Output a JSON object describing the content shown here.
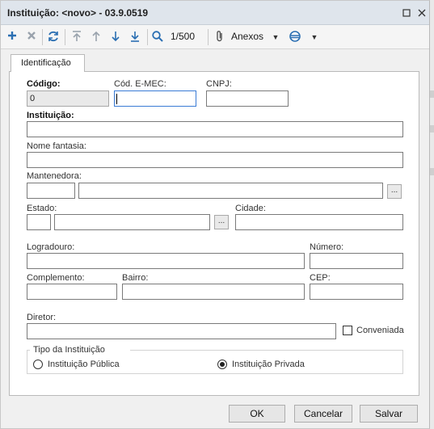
{
  "window": {
    "title": "Instituição: <novo> - 03.9.0519",
    "controls": {
      "restore_icon": "restore-icon",
      "close_icon": "close-icon"
    }
  },
  "toolbar": {
    "add_icon": "plus-icon",
    "delete_icon": "x-icon",
    "refresh_icon": "refresh-icon",
    "first_icon": "arrow-top-icon",
    "prev_icon": "arrow-up-icon",
    "next_icon": "arrow-down-icon",
    "last_icon": "arrow-bottom-icon",
    "search_icon": "magnifier-icon",
    "record_position": "1/500",
    "attachments_label": "Anexos",
    "attachments_icon": "paperclip-icon",
    "extra_icon": "db-icon"
  },
  "tabs": [
    {
      "label": "Identificação",
      "active": true
    }
  ],
  "form": {
    "codigo": {
      "label": "Código:",
      "value": "0"
    },
    "cod_emec": {
      "label": "Cód. E-MEC:",
      "value": ""
    },
    "cnpj": {
      "label": "CNPJ:",
      "value": ""
    },
    "instituicao": {
      "label": "Instituição:",
      "value": ""
    },
    "nome_fantasia": {
      "label": "Nome fantasia:",
      "value": ""
    },
    "mantenedora": {
      "label": "Mantenedora:",
      "code": "",
      "name": "",
      "lookup": "..."
    },
    "estado": {
      "label": "Estado:",
      "code": "",
      "name": "",
      "lookup": "..."
    },
    "cidade": {
      "label": "Cidade:",
      "value": ""
    },
    "logradouro": {
      "label": "Logradouro:",
      "value": ""
    },
    "numero": {
      "label": "Número:",
      "value": ""
    },
    "complemento": {
      "label": "Complemento:",
      "value": ""
    },
    "bairro": {
      "label": "Bairro:",
      "value": ""
    },
    "cep": {
      "label": "CEP:",
      "value": ""
    },
    "diretor": {
      "label": "Diretor:",
      "value": ""
    },
    "conveniada": {
      "label": "Conveniada",
      "checked": false
    },
    "tipo": {
      "legend": "Tipo da Instituição",
      "options": [
        {
          "label": "Instituição Pública",
          "selected": false
        },
        {
          "label": "Instituição Privada",
          "selected": true
        }
      ]
    }
  },
  "buttons": {
    "ok": "OK",
    "cancel": "Cancelar",
    "save": "Salvar"
  }
}
